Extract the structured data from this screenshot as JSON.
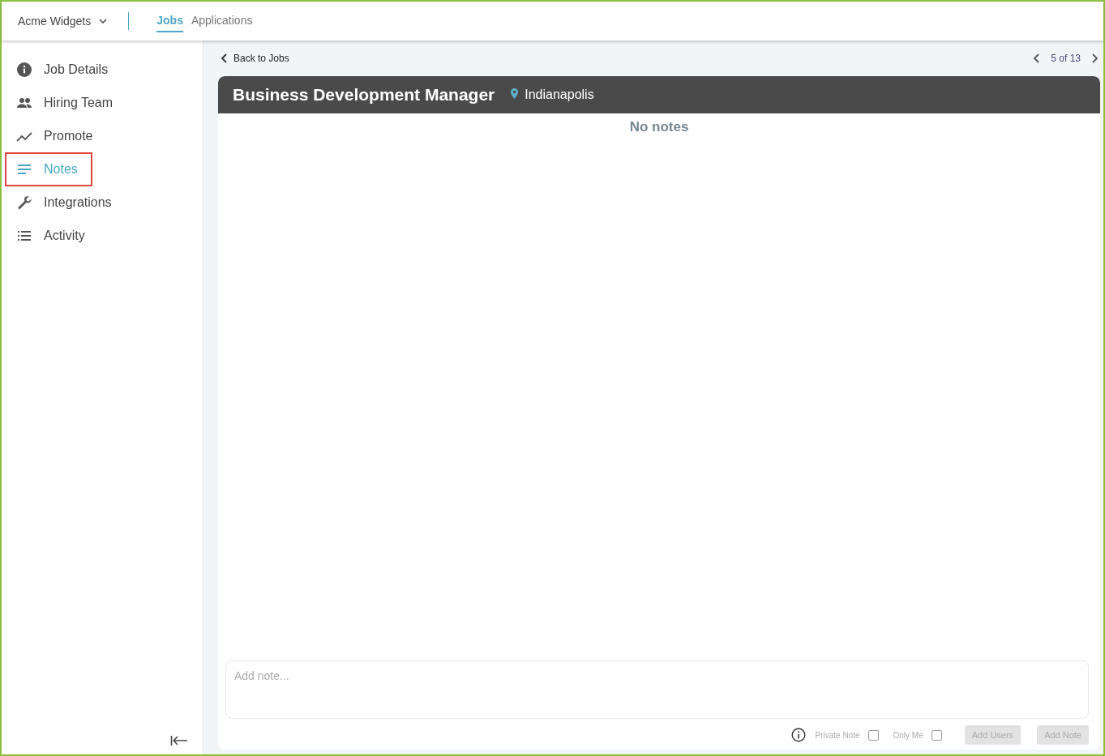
{
  "header": {
    "company": "Acme Widgets",
    "tabs": [
      {
        "label": "Jobs",
        "selected": true
      },
      {
        "label": "Applications",
        "selected": false
      }
    ]
  },
  "sidebar": {
    "items": [
      {
        "label": "Job Details",
        "selected": false
      },
      {
        "label": "Hiring Team",
        "selected": false
      },
      {
        "label": "Promote",
        "selected": false
      },
      {
        "label": "Notes",
        "selected": true
      },
      {
        "label": "Integrations",
        "selected": false
      },
      {
        "label": "Activity",
        "selected": false
      }
    ]
  },
  "nav": {
    "back": "Back to Jobs",
    "position": "5 of 13"
  },
  "job": {
    "title": "Business Development Manager",
    "location": "Indianapolis"
  },
  "notes": {
    "empty_message": "No notes"
  },
  "composer": {
    "placeholder": "Add note...",
    "options": [
      {
        "label": "Private Note",
        "checked": false
      },
      {
        "label": "Only Me",
        "checked": false
      }
    ],
    "buttons": [
      {
        "label": "Add Users",
        "disabled": true
      },
      {
        "label": "Add Note",
        "disabled": true
      }
    ]
  }
}
